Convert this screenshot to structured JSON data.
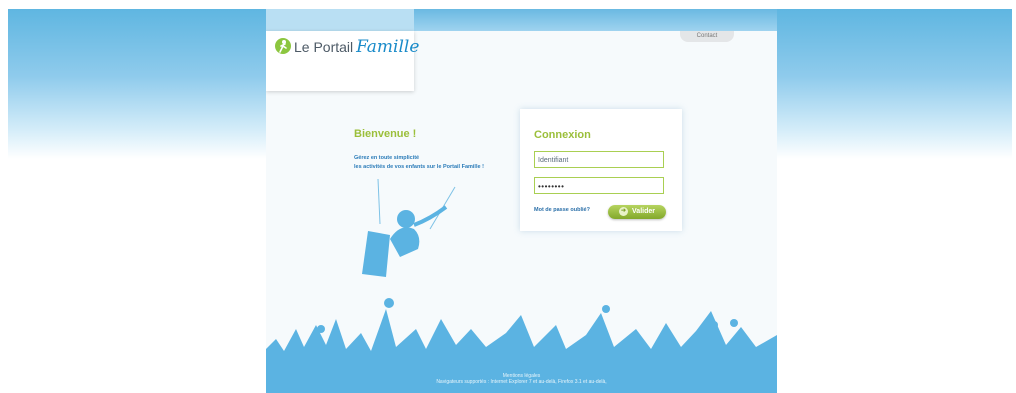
{
  "header": {
    "contact_label": "Contact",
    "logo_prefix": "Le Portail",
    "logo_suffix": "Famille"
  },
  "welcome": {
    "title": "Bienvenue !",
    "line1": "Gérez en toute simplicité",
    "line2": "les activités de vos enfants sur le Portail Famille !"
  },
  "login": {
    "title": "Connexion",
    "username_placeholder": "Identifiant",
    "password_mask": "••••••••",
    "forgot_label": "Mot de passe oublié?",
    "submit_label": "Valider",
    "submit_icon": "arrow-right-icon"
  },
  "footer": {
    "legal_label": "Mentions légales",
    "browsers": "Navigateurs supportés : Internet Explorer 7 et au-delà, Firefox 3.1 et au-delà,"
  },
  "colors": {
    "accent_green": "#9bbf3a",
    "brand_blue": "#1a8bc9",
    "sky_blue": "#5fb6e1"
  }
}
